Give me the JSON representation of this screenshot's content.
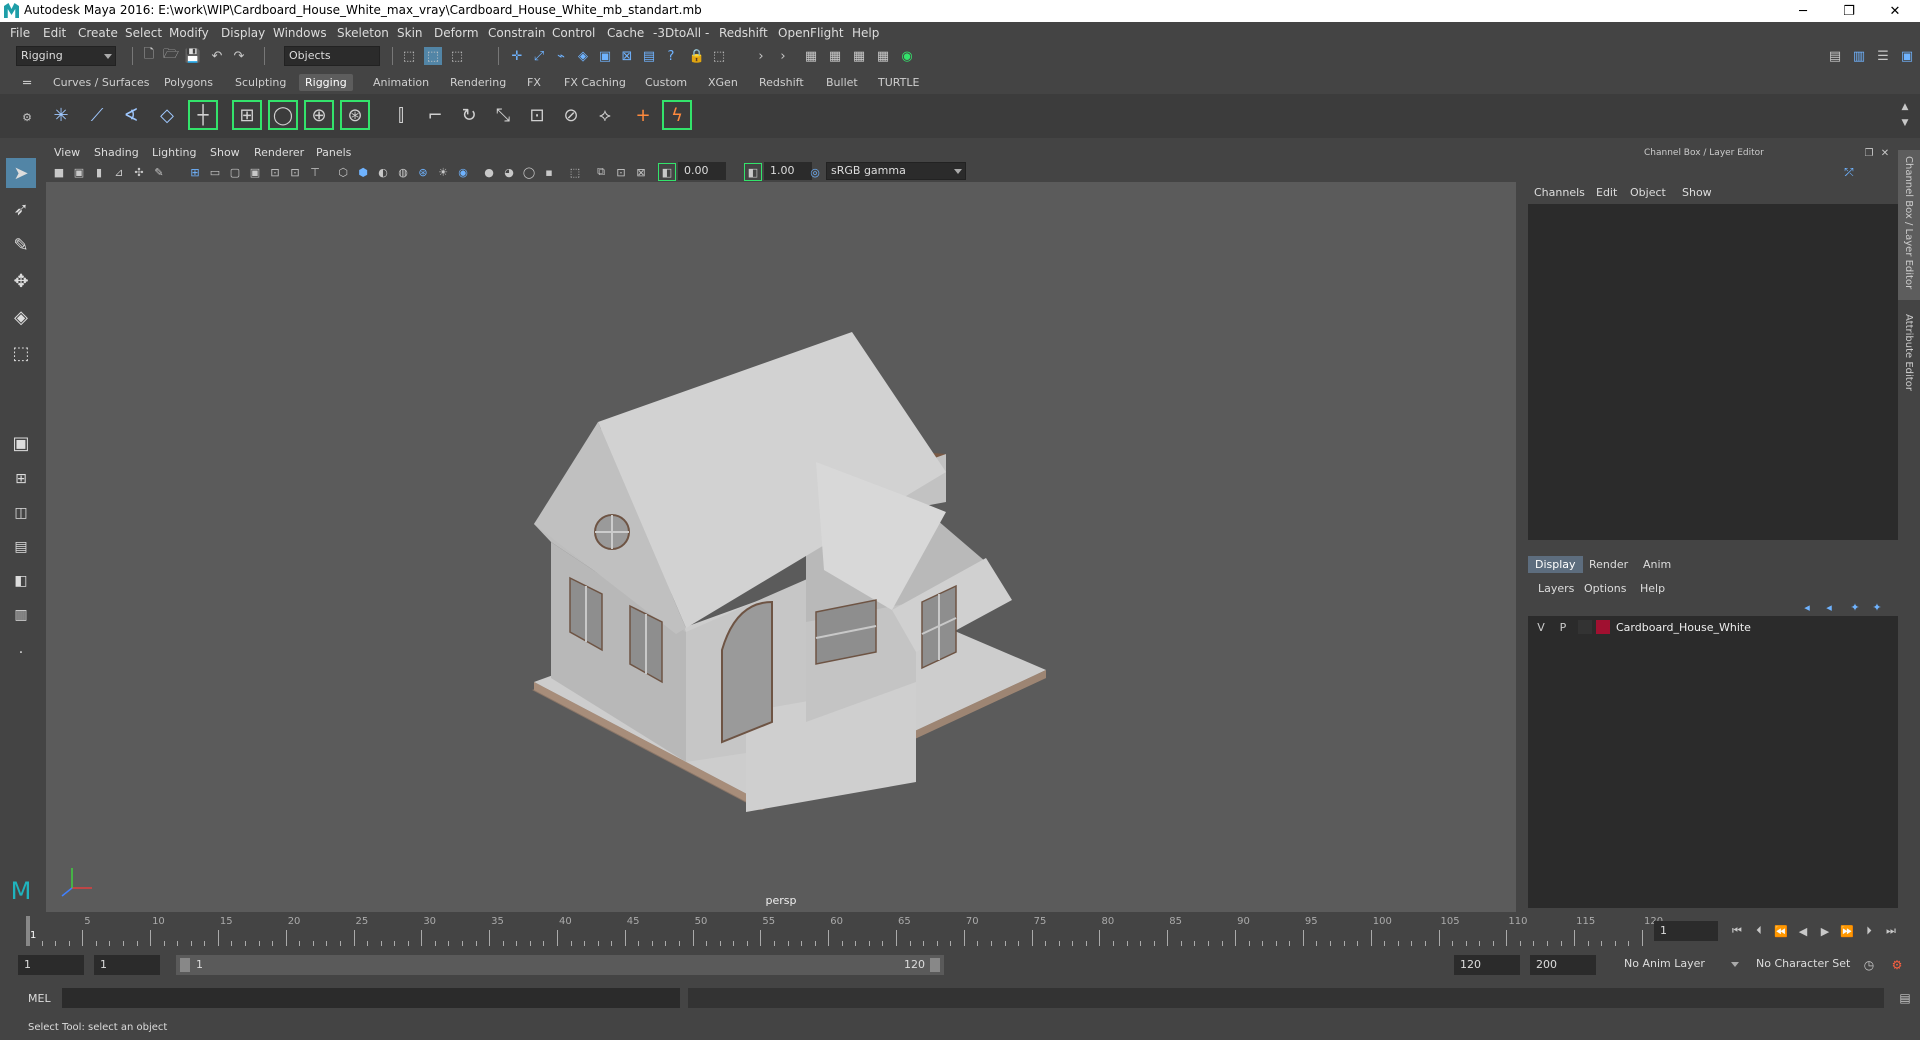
{
  "window": {
    "title": "Autodesk Maya 2016: E:\\work\\WIP\\Cardboard_House_White_max_vray\\Cardboard_House_White_mb_standart.mb",
    "minimize": "─",
    "restore": "❐",
    "close": "✕"
  },
  "menubar": [
    "File",
    "Edit",
    "Create",
    "Select",
    "Modify",
    "Display",
    "Windows",
    "Skeleton",
    "Skin",
    "Deform",
    "Constrain",
    "Control",
    "Cache",
    "-3DtoAll -",
    "Redshift",
    "OpenFlight",
    "Help"
  ],
  "statusline": {
    "menu_set": "Rigging",
    "selection_mode": "Objects"
  },
  "shelf_tabs": [
    "Curves / Surfaces",
    "Polygons",
    "Sculpting",
    "Rigging",
    "Animation",
    "Rendering",
    "FX",
    "FX Caching",
    "Custom",
    "XGen",
    "Redshift",
    "Bullet",
    "TURTLE"
  ],
  "active_shelf_tab": "Rigging",
  "viewport": {
    "menus": [
      "View",
      "Shading",
      "Lighting",
      "Show",
      "Renderer",
      "Panels"
    ],
    "exposure": "0.00",
    "gamma": "1.00",
    "color_space": "sRGB gamma",
    "camera": "persp"
  },
  "channel_box": {
    "title": "Channel Box / Layer Editor",
    "menus": [
      "Channels",
      "Edit",
      "Object",
      "Show"
    ]
  },
  "layer_editor": {
    "tabs": [
      "Display",
      "Render",
      "Anim"
    ],
    "active_tab": "Display",
    "menus": [
      "Layers",
      "Options",
      "Help"
    ],
    "layers": [
      {
        "visible": "V",
        "playback": "P",
        "name": "Cardboard_House_White",
        "color": "#a01030"
      }
    ]
  },
  "side_tabs": [
    "Channel Box / Layer Editor",
    "Attribute Editor"
  ],
  "timeline": {
    "ticks": [
      "1",
      "5",
      "10",
      "15",
      "20",
      "25",
      "30",
      "35",
      "40",
      "45",
      "50",
      "55",
      "60",
      "65",
      "70",
      "75",
      "80",
      "85",
      "90",
      "95",
      "100",
      "105",
      "110",
      "115",
      "120"
    ],
    "current_frame": "1"
  },
  "range": {
    "start": "1",
    "playback_start": "1",
    "slider_start": "1",
    "slider_end": "120",
    "playback_end": "120",
    "end": "200",
    "anim_layer": "No Anim Layer",
    "character_set": "No Character Set"
  },
  "command_line": {
    "label": "MEL"
  },
  "help_line": "Select Tool: select an object",
  "colors": {
    "accent_green": "#33e36b",
    "active_tool": "#5285a6",
    "layer_color": "#a01030"
  }
}
